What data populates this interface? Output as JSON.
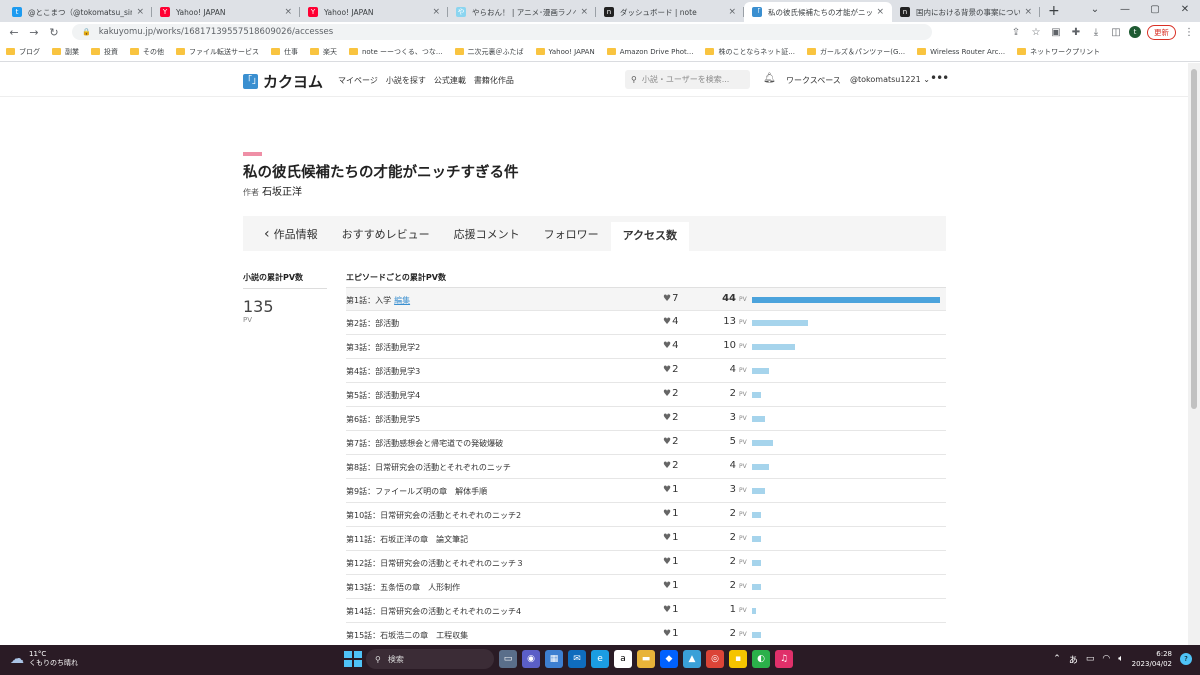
{
  "browser": {
    "tabs": [
      {
        "title": "@とこまつ（@tokomatsu_sin）さん",
        "color": "#1d9bf0",
        "glyph": "t"
      },
      {
        "title": "Yahoo! JAPAN",
        "color": "#ff0033",
        "glyph": "Y"
      },
      {
        "title": "Yahoo! JAPAN",
        "color": "#ff0033",
        "glyph": "Y"
      },
      {
        "title": "やらおん！ | アニメ･漫画ラノベ･ゲー",
        "color": "#8bd5f0",
        "glyph": "や"
      },
      {
        "title": "ダッシュボード | note",
        "color": "#222222",
        "glyph": "n"
      },
      {
        "title": "私の彼氏候補たちの才能がニッチす",
        "color": "#3a8fd0",
        "glyph": "「"
      },
      {
        "title": "国内における背景の事案について",
        "color": "#222222",
        "glyph": "n"
      }
    ],
    "active_tab_index": 5,
    "new_tab": "+",
    "url": "kakuyomu.jp/works/16817139557518609026/accesses",
    "update_label": "更新",
    "profile_initial": "t",
    "bookmarks": [
      "ブログ",
      "副業",
      "投資",
      "その他",
      "ファイル転送サービス",
      "仕事",
      "楽天",
      "note ーーつくる、つな...",
      "二次元裏＠ふたば",
      "Yahoo! JAPAN",
      "Amazon Drive Phot...",
      "株のことならネット証...",
      "ガールズ＆パンツァー(G...",
      "Wireless Router Arc...",
      "ネットワークプリント"
    ]
  },
  "site": {
    "logo_text": "カクヨム",
    "logo_mark": "「」",
    "nav": [
      "マイページ",
      "小説を探す",
      "公式連載",
      "書籍化作品"
    ],
    "search_placeholder": "小説・ユーザーを検索...",
    "workspace": "ワークスペース",
    "user": "@tokomatsu1221",
    "user_caret": "⌄",
    "more": "•••"
  },
  "work": {
    "title": "私の彼氏候補たちの才能がニッチすぎる件",
    "author_label": "作者",
    "author": "石坂正洋"
  },
  "work_tabs": [
    "作品情報",
    "おすすめレビュー",
    "応援コメント",
    "フォロワー",
    "アクセス数"
  ],
  "work_tabs_active": 4,
  "back_chevron": "‹",
  "stats": {
    "total_heading": "小説の累計PV数",
    "total_value": "135",
    "total_unit": "PV",
    "episode_heading": "エピソードごとの累計PV数",
    "pv_unit": "PV",
    "edit_label": "編集",
    "max_pv": 44,
    "episodes": [
      {
        "title": "第1話：入学",
        "hearts": "7",
        "pv": 44
      },
      {
        "title": "第2話：部活動",
        "hearts": "4",
        "pv": 13
      },
      {
        "title": "第3話：部活動見学2",
        "hearts": "4",
        "pv": 10
      },
      {
        "title": "第4話：部活動見学3",
        "hearts": "2",
        "pv": 4
      },
      {
        "title": "第5話：部活動見学4",
        "hearts": "2",
        "pv": 2
      },
      {
        "title": "第6話：部活動見学5",
        "hearts": "2",
        "pv": 3
      },
      {
        "title": "第7話：部活動感想会と帰宅道での発破爆破",
        "hearts": "2",
        "pv": 5
      },
      {
        "title": "第8話：日常研究会の活動とそれぞれのニッチ",
        "hearts": "2",
        "pv": 4
      },
      {
        "title": "第9話：ファイールズ明の章　解体手順",
        "hearts": "1",
        "pv": 3
      },
      {
        "title": "第10話：日常研究会の活動とそれぞれのニッチ2",
        "hearts": "1",
        "pv": 2
      },
      {
        "title": "第11話：石坂正洋の章　論文筆記",
        "hearts": "1",
        "pv": 2
      },
      {
        "title": "第12話：日常研究会の活動とそれぞれのニッチ３",
        "hearts": "1",
        "pv": 2
      },
      {
        "title": "第13話：五条悟の章　人形制作",
        "hearts": "1",
        "pv": 2
      },
      {
        "title": "第14話：日常研究会の活動とそれぞれのニッチ4",
        "hearts": "1",
        "pv": 1
      },
      {
        "title": "第15話：石坂浩二の章　工程収集",
        "hearts": "1",
        "pv": 2
      }
    ]
  },
  "taskbar": {
    "temp": "11°C",
    "weather": "くもりのち晴れ",
    "search_label": "検索",
    "ime": "あ",
    "time": "6:28",
    "date": "2023/04/02",
    "notif": "?"
  }
}
